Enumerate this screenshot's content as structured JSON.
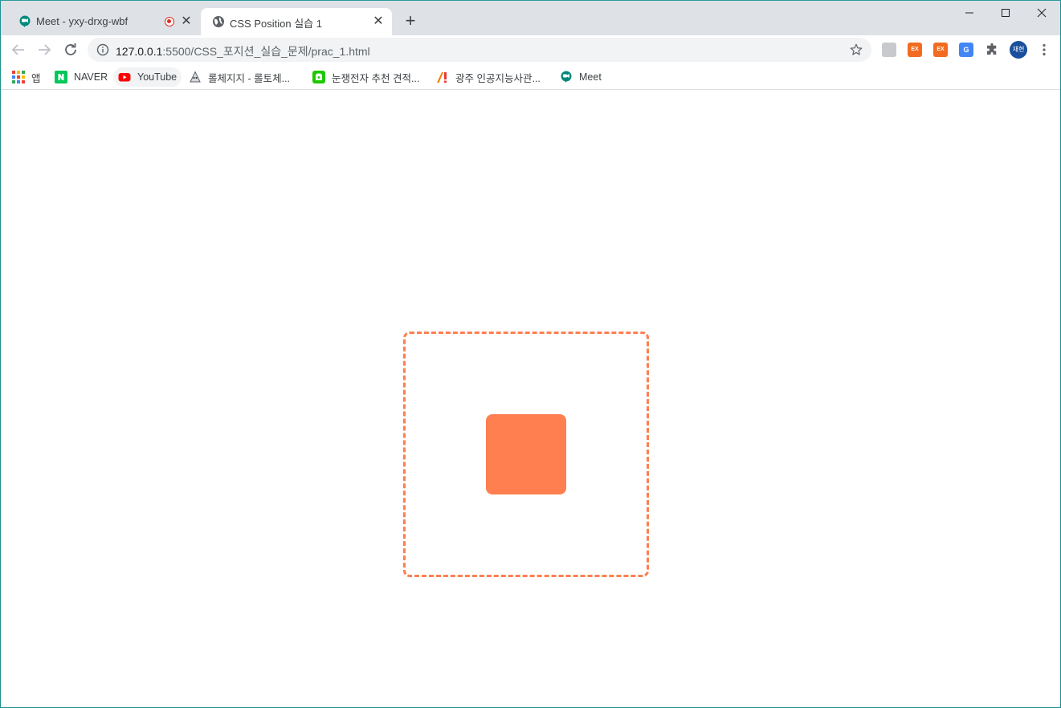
{
  "browser": {
    "tabs": [
      {
        "title": "Meet - yxy-drxg-wbf",
        "icon": "meet-icon",
        "recording": true,
        "active": false
      },
      {
        "title": "CSS Position 실습 1",
        "icon": "globe-icon",
        "active": true
      }
    ],
    "close_glyph": "✕",
    "new_tab_glyph": "+",
    "address": {
      "host": "127.0.0.1",
      "path": ":5500/CSS_포지션_실습_문제/prac_1.html"
    },
    "avatar_text": "재현",
    "extensions": {
      "e2": "EX",
      "e3": "EX",
      "e4": "G"
    }
  },
  "bookmarks": [
    {
      "label": "앱",
      "icon": "apps-grid-icon"
    },
    {
      "label": "NAVER",
      "icon": "naver-icon"
    },
    {
      "label": "YouTube",
      "icon": "youtube-icon"
    },
    {
      "label": "롤체지지 - 롤토체...",
      "icon": "lolchess-icon"
    },
    {
      "label": "눈쟁전자 추천 견적...",
      "icon": "shop-icon"
    },
    {
      "label": "광주 인공지능사관...",
      "icon": "ai-academy-icon"
    },
    {
      "label": "Meet",
      "icon": "meet-icon"
    }
  ],
  "page": {
    "accent_color": "#ff7f50",
    "outer_box": {
      "style": "dashed"
    },
    "inner_box": {
      "style": "solid"
    }
  }
}
